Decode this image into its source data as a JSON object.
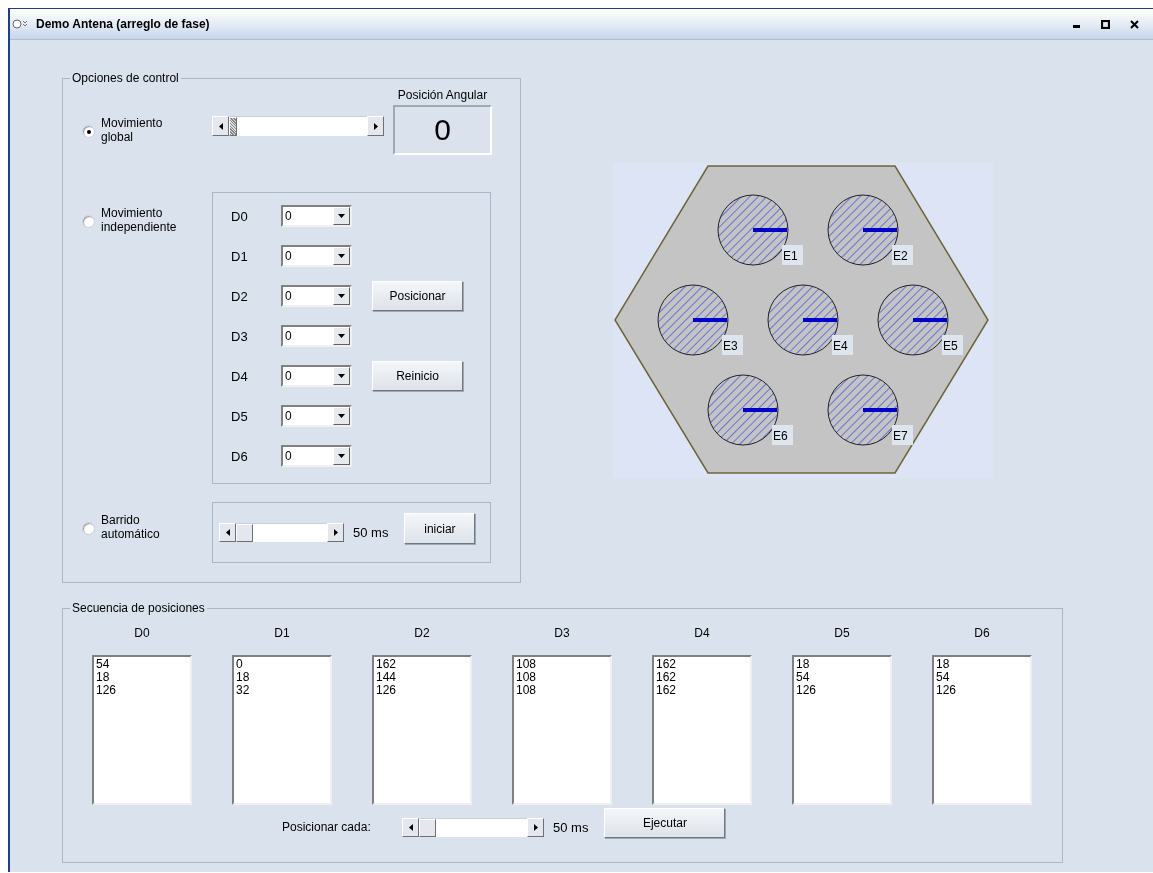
{
  "window": {
    "title": "Demo Antena (arreglo de fase)"
  },
  "control_options": {
    "title": "Opciones de control",
    "global": {
      "label": "Movimiento global",
      "selected": true,
      "slider": {
        "level": 0
      },
      "display_label": "Posición Angular",
      "display_value": "0"
    },
    "independent": {
      "label": "Movimiento independiente",
      "selected": false,
      "dials": [
        {
          "label": "D0",
          "value": "0"
        },
        {
          "label": "D1",
          "value": "0"
        },
        {
          "label": "D2",
          "value": "0"
        },
        {
          "label": "D3",
          "value": "0"
        },
        {
          "label": "D4",
          "value": "0"
        },
        {
          "label": "D5",
          "value": "0"
        },
        {
          "label": "D6",
          "value": "0"
        }
      ],
      "buttons": [
        "Posicionar",
        "Reinicio"
      ]
    },
    "sweep": {
      "label": "Barrido automático",
      "selected": false,
      "slider": {
        "level": 0
      },
      "reading": "50 ms",
      "button": "iniciar"
    }
  },
  "antenna": {
    "elements": [
      {
        "label": "E1"
      },
      {
        "label": "E2"
      },
      {
        "label": "E3"
      },
      {
        "label": "E4"
      },
      {
        "label": "E5"
      },
      {
        "label": "E6"
      },
      {
        "label": "E7"
      }
    ]
  },
  "sequence": {
    "title": "Secuencia de posiciones",
    "columns": [
      {
        "header": "D0",
        "values": [
          "54",
          "18",
          "126"
        ]
      },
      {
        "header": "D1",
        "values": [
          "0",
          "18",
          "32"
        ]
      },
      {
        "header": "D2",
        "values": [
          "162",
          "144",
          "126"
        ]
      },
      {
        "header": "D3",
        "values": [
          "108",
          "108",
          "108"
        ]
      },
      {
        "header": "D4",
        "values": [
          "162",
          "162",
          "162"
        ]
      },
      {
        "header": "D5",
        "values": [
          "18",
          "54",
          "126"
        ]
      },
      {
        "header": "D6",
        "values": [
          "18",
          "54",
          "126"
        ]
      }
    ],
    "footer": {
      "label": "Posicionar cada:",
      "slider": {
        "level": 0
      },
      "reading": "50 ms",
      "button": "Ejecutar"
    }
  }
}
